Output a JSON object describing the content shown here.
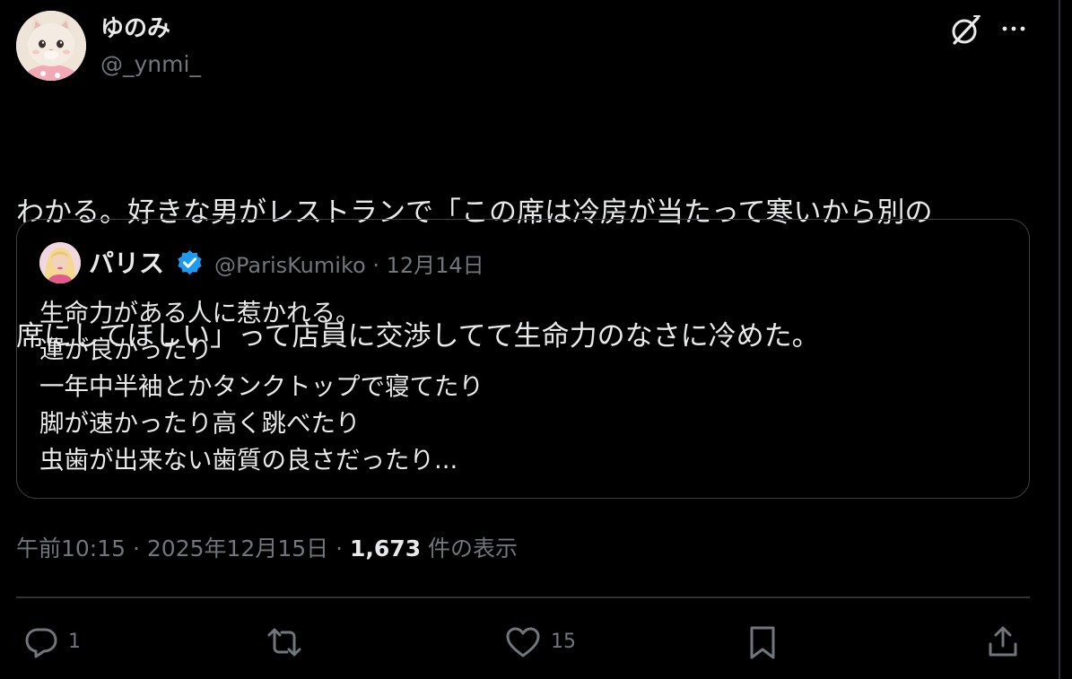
{
  "author": {
    "display_name": "ゆのみ",
    "handle": "@_ynmi_"
  },
  "tweet": {
    "text_line1": "わかる。好きな男がレストランで「この席は冷房が当たって寒いから別の",
    "text_line2": "席にしてほしい」って店員に交渉してて生命力のなさに冷めた。"
  },
  "quote": {
    "display_name": "パリス",
    "verified": true,
    "handle": "@ParisKumiko",
    "separator": "·",
    "date": "12月14日",
    "lines": [
      "生命力がある人に惹かれる。",
      "運が良かったり",
      "一年中半袖とかタンクトップで寝てたり",
      "脚が速かったり高く跳べたり",
      "虫歯が出来ない歯質の良さだったり..."
    ]
  },
  "meta": {
    "time": "午前10:15",
    "separator": "·",
    "date": "2025年12月15日",
    "views_count": "1,673",
    "views_label": "件の表示"
  },
  "actions": {
    "reply_count": "1",
    "retweet_count": "",
    "like_count": "15"
  },
  "icons": {
    "grok": "grok-icon",
    "more": "more-icon",
    "verified": "verified-badge-icon",
    "reply": "reply-icon",
    "retweet": "retweet-icon",
    "like": "heart-icon",
    "bookmark": "bookmark-icon",
    "share": "share-icon"
  },
  "colors": {
    "background": "#000000",
    "text_primary": "#e7e9ea",
    "text_secondary": "#71767b",
    "border": "#2f3336",
    "verified_blue": "#1d9bf0"
  }
}
